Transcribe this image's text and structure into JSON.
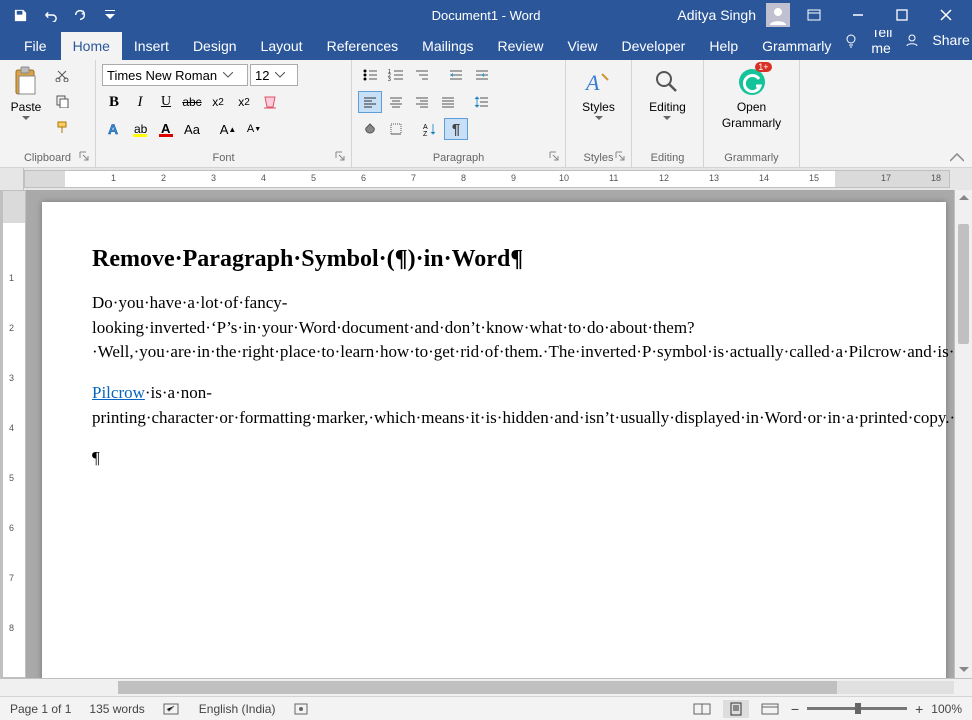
{
  "titlebar": {
    "doc_title": "Document1 - Word",
    "user_name": "Aditya Singh"
  },
  "tabs": {
    "file": "File",
    "home": "Home",
    "insert": "Insert",
    "design": "Design",
    "layout": "Layout",
    "references": "References",
    "mailings": "Mailings",
    "review": "Review",
    "view": "View",
    "developer": "Developer",
    "help": "Help",
    "grammarly": "Grammarly",
    "tellme": "Tell me",
    "share": "Share"
  },
  "ribbon": {
    "clipboard_label": "Clipboard",
    "paste_label": "Paste",
    "font_label": "Font",
    "font_name": "Times New Roman",
    "font_size": "12",
    "paragraph_label": "Paragraph",
    "styles_label": "Styles",
    "styles_btn": "Styles",
    "editing_label": "Editing",
    "editing_btn": "Editing",
    "grammarly_label": "Grammarly",
    "grammarly_btn_l1": "Open",
    "grammarly_btn_l2": "Grammarly"
  },
  "ruler_ticks": [
    "1",
    "2",
    "3",
    "4",
    "5",
    "6",
    "7",
    "8",
    "9",
    "10",
    "11",
    "12",
    "13",
    "14",
    "15",
    "17",
    "18"
  ],
  "vruler_ticks": [
    "1",
    "2",
    "3",
    "4",
    "5",
    "6",
    "7",
    "8"
  ],
  "document": {
    "heading": "Remove·Paragraph·Symbol·(¶)·in·Word¶",
    "p1": "Do·you·have·a·lot·of·fancy-looking·inverted·‘P’s·in·your·Word·document·and·don’t·know·what·to·do·about·them?·Well,·you·are·in·the·right·place·to·learn·how·to·get·rid·of·them.·The·inverted·P·symbol·is·actually·called·a·Pilcrow·and·is·used·to·mark·a·new·paragraph·or·a·new·section·of·a·text.·It·is·also·called·the·paragraph·sign,·Alinea,·the·blind·P·but·most·popularly·the·paragraph·mark.¶",
    "p2_link": "Pilcrow",
    "p2_rest": "·is·a·non-printing·character·or·formatting·marker,·which·means·it·is·hidden·and·isn’t·usually·displayed·in·Word·or·in·a·printed·copy.·In·the·simplest·of·terms,·the·number·of·paragraph·marks·in·a·document·is·equal·to·the·number·of·times·you·have·hit·the·enter·key·while·typing.¶",
    "p3": "¶"
  },
  "statusbar": {
    "page": "Page 1 of 1",
    "words": "135 words",
    "lang": "English (India)",
    "zoom": "100%"
  }
}
